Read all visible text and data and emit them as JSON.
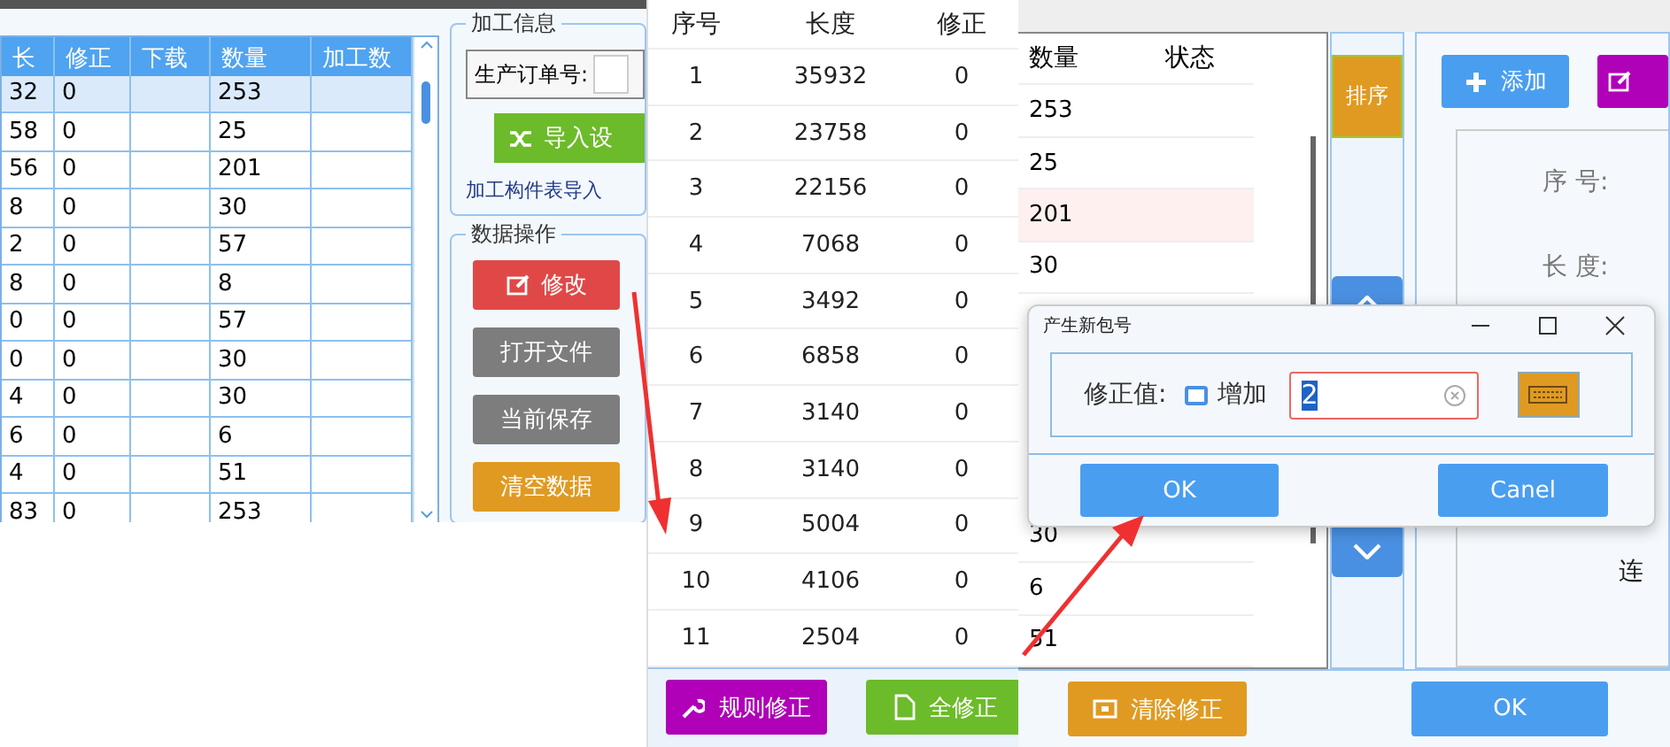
{
  "left_window": {
    "table": {
      "columns": [
        "长",
        "修正",
        "下载",
        "数量",
        "加工数"
      ],
      "rows": [
        {
          "cells": [
            "32",
            "0",
            "",
            "253",
            ""
          ],
          "selected": true
        },
        {
          "cells": [
            "58",
            "0",
            "",
            "25",
            ""
          ],
          "selected": false
        },
        {
          "cells": [
            "56",
            "0",
            "",
            "201",
            ""
          ],
          "selected": false
        },
        {
          "cells": [
            "8",
            "0",
            "",
            "30",
            ""
          ],
          "selected": false
        },
        {
          "cells": [
            "2",
            "0",
            "",
            "57",
            ""
          ],
          "selected": false
        },
        {
          "cells": [
            "8",
            "0",
            "",
            "8",
            ""
          ],
          "selected": false
        },
        {
          "cells": [
            "0",
            "0",
            "",
            "57",
            ""
          ],
          "selected": false
        },
        {
          "cells": [
            "0",
            "0",
            "",
            "30",
            ""
          ],
          "selected": false
        },
        {
          "cells": [
            "4",
            "0",
            "",
            "30",
            ""
          ],
          "selected": false
        },
        {
          "cells": [
            "6",
            "0",
            "",
            "6",
            ""
          ],
          "selected": false
        },
        {
          "cells": [
            "4",
            "0",
            "",
            "51",
            ""
          ],
          "selected": false
        },
        {
          "cells": [
            "83",
            "0",
            "",
            "253",
            ""
          ],
          "selected": false
        }
      ]
    },
    "info_group": {
      "title": "加工信息",
      "order_label": "生产订单号:",
      "import_button": "导入设",
      "import_hint": "加工构件表导入"
    },
    "data_group": {
      "title": "数据操作",
      "buttons": [
        {
          "label": "修改",
          "kind": "edit"
        },
        {
          "label": "打开文件",
          "kind": "plain"
        },
        {
          "label": "当前保存",
          "kind": "plain"
        },
        {
          "label": "清空数据",
          "kind": "warn"
        }
      ]
    }
  },
  "middle_window": {
    "columns": [
      "序号",
      "长度",
      "修正"
    ],
    "rows": [
      [
        "1",
        "35932",
        "0"
      ],
      [
        "2",
        "23758",
        "0"
      ],
      [
        "3",
        "22156",
        "0"
      ],
      [
        "4",
        "7068",
        "0"
      ],
      [
        "5",
        "3492",
        "0"
      ],
      [
        "6",
        "6858",
        "0"
      ],
      [
        "7",
        "3140",
        "0"
      ],
      [
        "8",
        "3140",
        "0"
      ],
      [
        "9",
        "5004",
        "0"
      ],
      [
        "10",
        "4106",
        "0"
      ],
      [
        "11",
        "2504",
        "0"
      ]
    ],
    "buttons": [
      {
        "label": "规则修正",
        "kind": "rule"
      },
      {
        "label": "全修正",
        "kind": "all"
      }
    ]
  },
  "right_window": {
    "columns": [
      "数量",
      "状态"
    ],
    "rows_top": [
      {
        "qty": "253",
        "selected": false
      },
      {
        "qty": "25",
        "selected": false
      },
      {
        "qty": "201",
        "selected": true
      },
      {
        "qty": "30",
        "selected": false
      }
    ],
    "rows_bottom": [
      {
        "qty": "30",
        "selected": false
      },
      {
        "qty": "6",
        "selected": false
      },
      {
        "qty": "51",
        "selected": false
      }
    ],
    "sort_button": "排序",
    "add_button": "添加",
    "form_labels": [
      "序 号:",
      "长 度:"
    ],
    "lower_label": "连",
    "clear_button": "清除修正",
    "ok_button": "OK"
  },
  "dialog": {
    "title": "产生新包号",
    "field_label": "修正值:",
    "checkbox": {
      "label": "增加",
      "checked": false
    },
    "input": {
      "value": "2"
    },
    "buttons": [
      "OK",
      "Canel"
    ]
  }
}
